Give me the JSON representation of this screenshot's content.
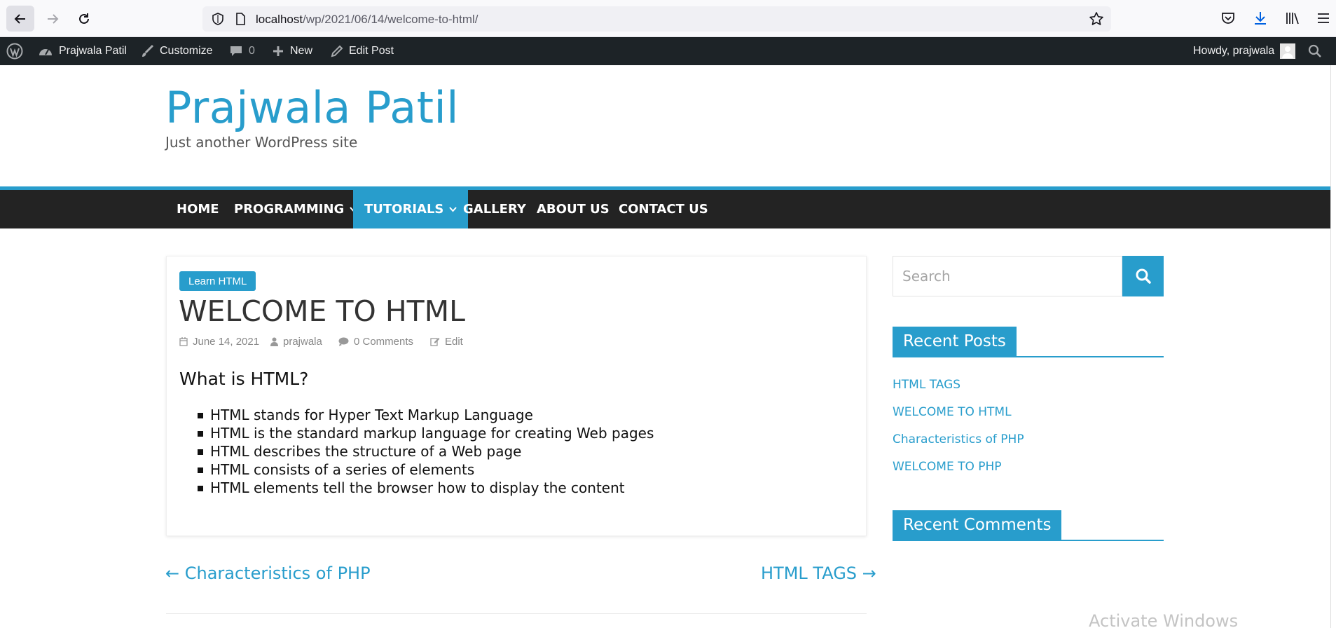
{
  "browser": {
    "url_host": "localhost",
    "url_path": "/wp/2021/06/14/welcome-to-html/"
  },
  "admin_bar": {
    "site_name": "Prajwala Patil",
    "customize": "Customize",
    "comments_count": "0",
    "new_label": "New",
    "edit_post": "Edit Post",
    "howdy": "Howdy, prajwala"
  },
  "site": {
    "title": "Prajwala Patil",
    "description": "Just another WordPress site"
  },
  "nav": {
    "items": [
      {
        "label": "HOME"
      },
      {
        "label": "PROGRAMMING"
      },
      {
        "label": "TUTORIALS"
      },
      {
        "label": "GALLERY"
      },
      {
        "label": "ABOUT US"
      },
      {
        "label": "CONTACT US"
      }
    ]
  },
  "post": {
    "category": "Learn HTML",
    "title": "WELCOME TO HTML",
    "date": "June 14, 2021",
    "author": "prajwala",
    "comments": "0 Comments",
    "edit": "Edit",
    "heading": "What is HTML?",
    "list": [
      "HTML stands for Hyper Text Markup Language",
      "HTML is the standard markup language for creating Web pages",
      "HTML describes the structure of a Web page",
      "HTML consists of a series of elements",
      "HTML elements tell the browser how to display the content"
    ],
    "prev": "← Characteristics of PHP",
    "next": "HTML TAGS →"
  },
  "sidebar": {
    "search_placeholder": "Search",
    "recent_posts_title": "Recent Posts",
    "recent_posts": [
      "HTML TAGS",
      "WELCOME TO HTML",
      "Characteristics of PHP",
      "WELCOME TO PHP"
    ],
    "recent_comments_title": "Recent Comments"
  },
  "watermark": "Activate Windows",
  "colors": {
    "accent": "#289dcc",
    "nav_bg": "#232323",
    "admin_bar_bg": "#1d2327"
  }
}
